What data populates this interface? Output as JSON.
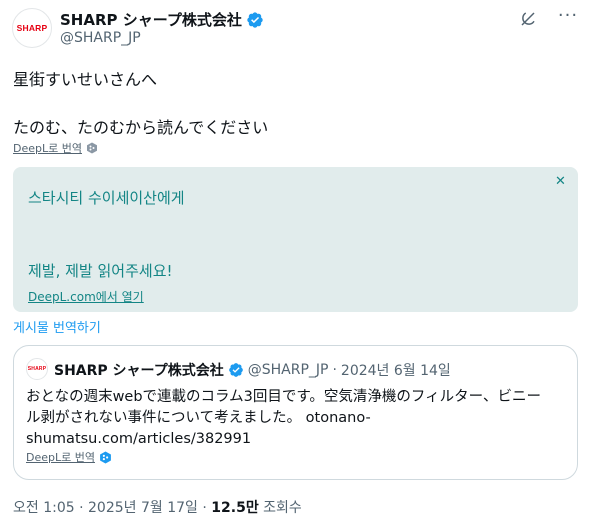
{
  "author": {
    "avatar_text": "SHARP",
    "display_name": "SHARP シャープ株式会社",
    "handle": "@SHARP_JP",
    "verified": true
  },
  "tweet": {
    "line1": "星街すいせいさんへ",
    "line2": "たのむ、たのむから読んでください",
    "deepl_label": "DeepL로 번역"
  },
  "translation": {
    "line1": "스타시티 수이세이산에게",
    "line2": "제발, 제발 읽어주세요!",
    "open_link": "DeepL.com에서 열기",
    "close_icon": "close-icon",
    "accent_color": "#138585"
  },
  "translate_post": "게시물 번역하기",
  "quote": {
    "avatar_text": "SHARP",
    "display_name": "SHARP シャープ株式会社",
    "handle": "@SHARP_JP",
    "separator": "·",
    "date": "2024년 6월 14일",
    "text_line1": "おとなの週末webで連載のコラム3回目です。空気清浄機のフィルター、ビニー",
    "text_line2": "ル剥がされない事件について考えました。 otonano-",
    "text_line3": "shumatsu.com/articles/382991",
    "deepl_label": "DeepL로 번역"
  },
  "footer": {
    "time": "오전 1:05",
    "sep1": "·",
    "date": "2025년 7월 17일",
    "sep2": "·",
    "views": "12.5만",
    "views_label": "조회수"
  },
  "colors": {
    "verified_blue": "#1d9bf0",
    "link_blue": "#1d9bf0",
    "sharp_red": "#e60012"
  }
}
